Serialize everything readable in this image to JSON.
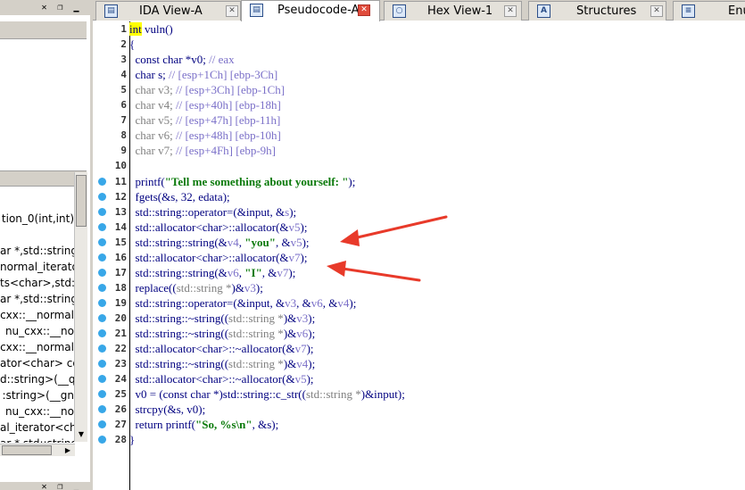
{
  "tabs": [
    {
      "label": "IDA View-A",
      "icon": "ida-view-icon",
      "active": false
    },
    {
      "label": "Pseudocode-A",
      "icon": "pseudocode-icon",
      "active": true
    },
    {
      "label": "Hex View-1",
      "icon": "hex-view-icon",
      "active": false
    },
    {
      "label": "Structures",
      "icon": "structures-icon",
      "active": false
    },
    {
      "label": "Enu",
      "icon": "enums-icon",
      "active": false
    }
  ],
  "left_pane": {
    "function_items": [
      "",
      "tion_0(int,int)",
      "",
      "ar *,std::string",
      "normal_iterato",
      "ts<char>,std::",
      "ar *,std::string",
      "cxx::__normal",
      "nu_cxx::__no",
      "cxx::__normal",
      "ator<char> co",
      "d::string>(__q",
      ":string>(__gn",
      "nu_cxx::__no",
      "al_iterator<ch",
      "ar *,std::string"
    ]
  },
  "code": {
    "lines": [
      {
        "n": "1",
        "bp": false,
        "parts": [
          [
            "hl",
            "int"
          ],
          [
            "id",
            " vuln()"
          ]
        ]
      },
      {
        "n": "2",
        "bp": false,
        "parts": [
          [
            "id",
            "{"
          ]
        ]
      },
      {
        "n": "3",
        "bp": false,
        "parts": [
          [
            "kw",
            "  const char *v0; "
          ],
          [
            "cmt",
            "// eax"
          ]
        ]
      },
      {
        "n": "4",
        "bp": false,
        "parts": [
          [
            "kw",
            "  char s; "
          ],
          [
            "cmt",
            "// [esp+1Ch] [ebp-3Ch]"
          ]
        ]
      },
      {
        "n": "5",
        "bp": false,
        "parts": [
          [
            "gray",
            "  char v3; "
          ],
          [
            "cmt",
            "// [esp+3Ch] [ebp-1Ch]"
          ]
        ]
      },
      {
        "n": "6",
        "bp": false,
        "parts": [
          [
            "gray",
            "  char v4; "
          ],
          [
            "cmt",
            "// [esp+40h] [ebp-18h]"
          ]
        ]
      },
      {
        "n": "7",
        "bp": false,
        "parts": [
          [
            "gray",
            "  char v5; "
          ],
          [
            "cmt",
            "// [esp+47h] [ebp-11h]"
          ]
        ]
      },
      {
        "n": "8",
        "bp": false,
        "parts": [
          [
            "gray",
            "  char v6; "
          ],
          [
            "cmt",
            "// [esp+48h] [ebp-10h]"
          ]
        ]
      },
      {
        "n": "9",
        "bp": false,
        "parts": [
          [
            "gray",
            "  char v7; "
          ],
          [
            "cmt",
            "// [esp+4Fh] [ebp-9h]"
          ]
        ]
      },
      {
        "n": "10",
        "bp": false,
        "parts": [
          [
            "id",
            ""
          ]
        ]
      },
      {
        "n": "11",
        "bp": true,
        "parts": [
          [
            "id",
            "  printf("
          ],
          [
            "str",
            "\"Tell me something about yourself: \""
          ],
          [
            "id",
            ");"
          ]
        ]
      },
      {
        "n": "12",
        "bp": true,
        "parts": [
          [
            "id",
            "  fgets(&s, 32, edata);"
          ]
        ]
      },
      {
        "n": "13",
        "bp": true,
        "parts": [
          [
            "id",
            "  std::string::operator=(&input, &"
          ],
          [
            "var",
            "s"
          ],
          [
            "id",
            ");"
          ]
        ]
      },
      {
        "n": "14",
        "bp": true,
        "parts": [
          [
            "id",
            "  std::allocator<char>::allocator(&"
          ],
          [
            "var",
            "v5"
          ],
          [
            "id",
            ");"
          ]
        ]
      },
      {
        "n": "15",
        "bp": true,
        "parts": [
          [
            "id",
            "  std::string::string(&"
          ],
          [
            "var",
            "v4"
          ],
          [
            "id",
            ", "
          ],
          [
            "str",
            "\"you\""
          ],
          [
            "id",
            ", &"
          ],
          [
            "var",
            "v5"
          ],
          [
            "id",
            ");"
          ]
        ]
      },
      {
        "n": "16",
        "bp": true,
        "parts": [
          [
            "id",
            "  std::allocator<char>::allocator(&"
          ],
          [
            "var",
            "v7"
          ],
          [
            "id",
            ");"
          ]
        ]
      },
      {
        "n": "17",
        "bp": true,
        "parts": [
          [
            "id",
            "  std::string::string(&"
          ],
          [
            "var",
            "v6"
          ],
          [
            "id",
            ", "
          ],
          [
            "str",
            "\"I\""
          ],
          [
            "id",
            ", &"
          ],
          [
            "var",
            "v7"
          ],
          [
            "id",
            ");"
          ]
        ]
      },
      {
        "n": "18",
        "bp": true,
        "parts": [
          [
            "id",
            "  replace(("
          ],
          [
            "gray",
            "std::string *"
          ],
          [
            "id",
            ")&"
          ],
          [
            "var",
            "v3"
          ],
          [
            "id",
            ");"
          ]
        ]
      },
      {
        "n": "19",
        "bp": true,
        "parts": [
          [
            "id",
            "  std::string::operator=(&input, &"
          ],
          [
            "var",
            "v3"
          ],
          [
            "id",
            ", &"
          ],
          [
            "var",
            "v6"
          ],
          [
            "id",
            ", &"
          ],
          [
            "var",
            "v4"
          ],
          [
            "id",
            ");"
          ]
        ]
      },
      {
        "n": "20",
        "bp": true,
        "parts": [
          [
            "id",
            "  std::string::~string(("
          ],
          [
            "gray",
            "std::string *"
          ],
          [
            "id",
            ")&"
          ],
          [
            "var",
            "v3"
          ],
          [
            "id",
            ");"
          ]
        ]
      },
      {
        "n": "21",
        "bp": true,
        "parts": [
          [
            "id",
            "  std::string::~string(("
          ],
          [
            "gray",
            "std::string *"
          ],
          [
            "id",
            ")&"
          ],
          [
            "var",
            "v6"
          ],
          [
            "id",
            ");"
          ]
        ]
      },
      {
        "n": "22",
        "bp": true,
        "parts": [
          [
            "id",
            "  std::allocator<char>::~allocator(&"
          ],
          [
            "var",
            "v7"
          ],
          [
            "id",
            ");"
          ]
        ]
      },
      {
        "n": "23",
        "bp": true,
        "parts": [
          [
            "id",
            "  std::string::~string(("
          ],
          [
            "gray",
            "std::string *"
          ],
          [
            "id",
            ")&"
          ],
          [
            "var",
            "v4"
          ],
          [
            "id",
            ");"
          ]
        ]
      },
      {
        "n": "24",
        "bp": true,
        "parts": [
          [
            "id",
            "  std::allocator<char>::~allocator(&"
          ],
          [
            "var",
            "v5"
          ],
          [
            "id",
            ");"
          ]
        ]
      },
      {
        "n": "25",
        "bp": true,
        "parts": [
          [
            "id",
            "  v0 = (const char *)std::string::c_str(("
          ],
          [
            "gray",
            "std::string *"
          ],
          [
            "id",
            ")&input);"
          ]
        ]
      },
      {
        "n": "26",
        "bp": true,
        "parts": [
          [
            "id",
            "  strcpy(&s, v0);"
          ]
        ]
      },
      {
        "n": "27",
        "bp": true,
        "parts": [
          [
            "id",
            "  return printf("
          ],
          [
            "str",
            "\"So, %s\\n\""
          ],
          [
            "id",
            ", &s);"
          ]
        ]
      },
      {
        "n": "28",
        "bp": true,
        "parts": [
          [
            "id",
            "}"
          ]
        ]
      }
    ]
  },
  "colors": {
    "annotation_arrow": "#e83a2a",
    "breakpoint_dot": "#38a7e8",
    "code_text": "#000080",
    "string_literal": "#0a7a0a",
    "comment": "#7a6fc8"
  }
}
